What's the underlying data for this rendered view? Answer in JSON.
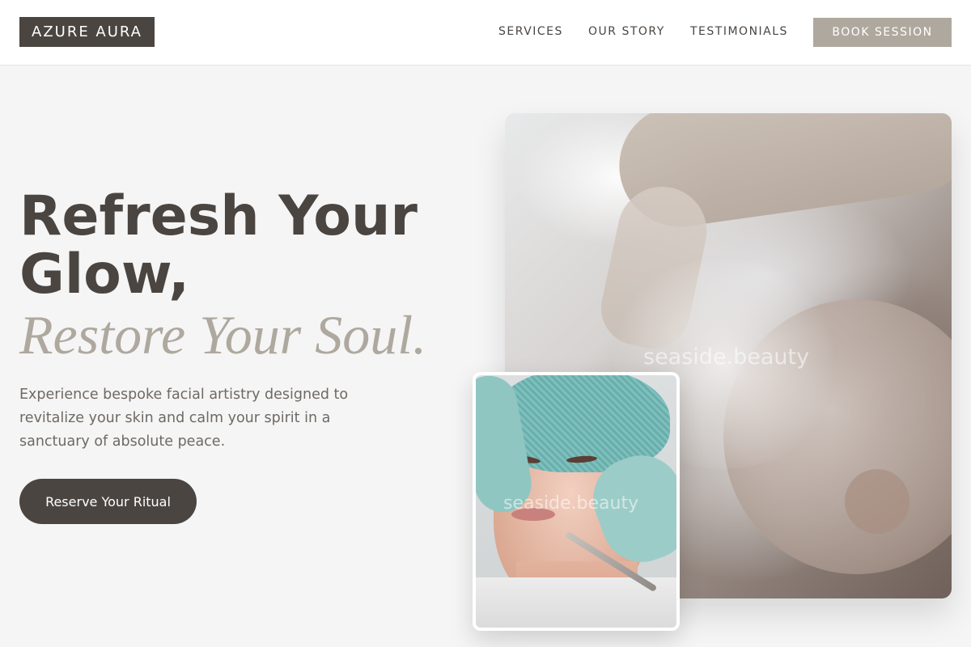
{
  "header": {
    "logo": "AZURE AURA",
    "nav": [
      {
        "label": "SERVICES"
      },
      {
        "label": "OUR STORY"
      },
      {
        "label": "TESTIMONIALS"
      }
    ],
    "book_button": "BOOK SESSION"
  },
  "hero": {
    "headline": "Refresh Your Glow,",
    "headline_italic": "Restore Your Soul.",
    "description": "Experience bespoke facial artistry designed to revitalize your skin and calm your spirit in a sanctuary of absolute peace.",
    "cta": "Reserve Your Ritual"
  },
  "images": {
    "main_watermark": "seaside.beauty",
    "small_watermark": "seaside.beauty"
  },
  "colors": {
    "primary": "#4a4541",
    "accent": "#aea89e",
    "background": "#f5f5f5"
  }
}
